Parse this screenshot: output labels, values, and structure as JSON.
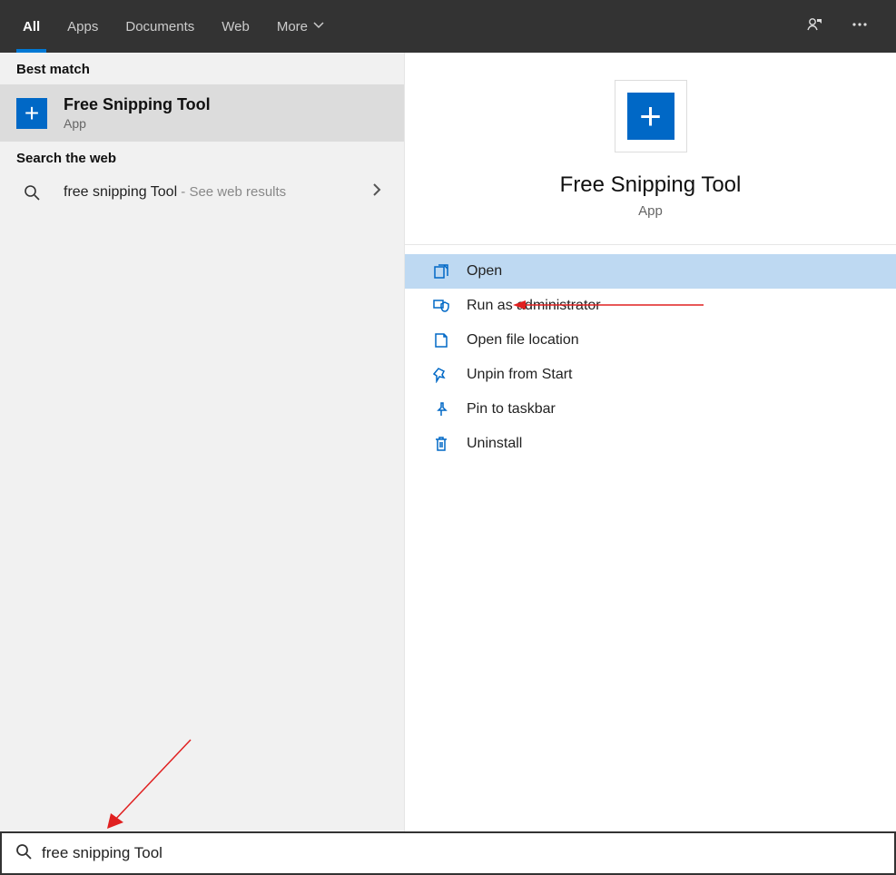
{
  "topbar": {
    "tabs": [
      {
        "label": "All",
        "active": true
      },
      {
        "label": "Apps",
        "active": false
      },
      {
        "label": "Documents",
        "active": false
      },
      {
        "label": "Web",
        "active": false
      },
      {
        "label": "More",
        "active": false,
        "dropdown": true
      }
    ]
  },
  "left": {
    "best_match_header": "Best match",
    "best_match": {
      "title": "Free Snipping Tool",
      "subtitle": "App",
      "icon": "plus-icon"
    },
    "search_web_header": "Search the web",
    "web_result": {
      "query": "free snipping Tool",
      "suffix": " - See web results"
    }
  },
  "detail": {
    "title": "Free Snipping Tool",
    "subtitle": "App",
    "icon": "plus-icon",
    "actions": [
      {
        "label": "Open",
        "icon": "open-icon",
        "highlight": true
      },
      {
        "label": "Run as administrator",
        "icon": "admin-shield-icon",
        "highlight": false
      },
      {
        "label": "Open file location",
        "icon": "folder-icon",
        "highlight": false
      },
      {
        "label": "Unpin from Start",
        "icon": "unpin-start-icon",
        "highlight": false
      },
      {
        "label": "Pin to taskbar",
        "icon": "pin-taskbar-icon",
        "highlight": false
      },
      {
        "label": "Uninstall",
        "icon": "trash-icon",
        "highlight": false
      }
    ]
  },
  "searchbar": {
    "value": "free snipping Tool"
  }
}
